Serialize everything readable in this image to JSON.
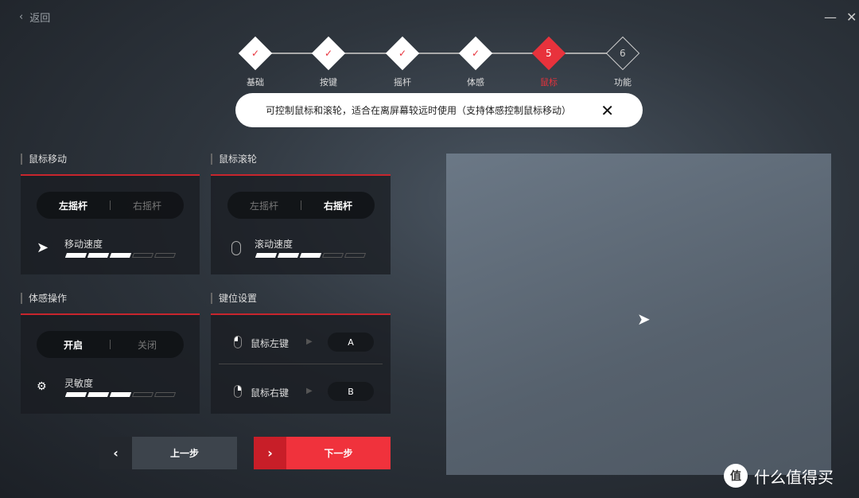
{
  "header": {
    "back_label": "返回"
  },
  "steps": [
    {
      "label": "基础",
      "state": "done",
      "glyph": "✓"
    },
    {
      "label": "按键",
      "state": "done",
      "glyph": "✓"
    },
    {
      "label": "摇杆",
      "state": "done",
      "glyph": "✓"
    },
    {
      "label": "体感",
      "state": "done",
      "glyph": "✓"
    },
    {
      "label": "鼠标",
      "state": "current",
      "glyph": "5"
    },
    {
      "label": "功能",
      "state": "todo",
      "glyph": "6"
    }
  ],
  "banner": {
    "text": "可控制鼠标和滚轮，适合在离屏幕较远时使用（支持体感控制鼠标移动）",
    "close": "✕"
  },
  "mouse_move": {
    "title": "鼠标移动",
    "options": [
      "左摇杆",
      "右摇杆"
    ],
    "selected": 0,
    "speed_label": "移动速度",
    "level": 3,
    "max": 5
  },
  "mouse_wheel": {
    "title": "鼠标滚轮",
    "options": [
      "左摇杆",
      "右摇杆"
    ],
    "selected": 1,
    "speed_label": "滚动速度",
    "level": 3,
    "max": 5
  },
  "motion": {
    "title": "体感操作",
    "options": [
      "开启",
      "关闭"
    ],
    "selected": 0,
    "sens_label": "灵敏度",
    "level": 3,
    "max": 5
  },
  "keymap": {
    "title": "键位设置",
    "rows": [
      {
        "label": "鼠标左键",
        "key": "A"
      },
      {
        "label": "鼠标右键",
        "key": "B"
      }
    ]
  },
  "nav": {
    "prev": "上一步",
    "next": "下一步"
  },
  "accent": "#e8323c",
  "watermark": "什么值得买"
}
